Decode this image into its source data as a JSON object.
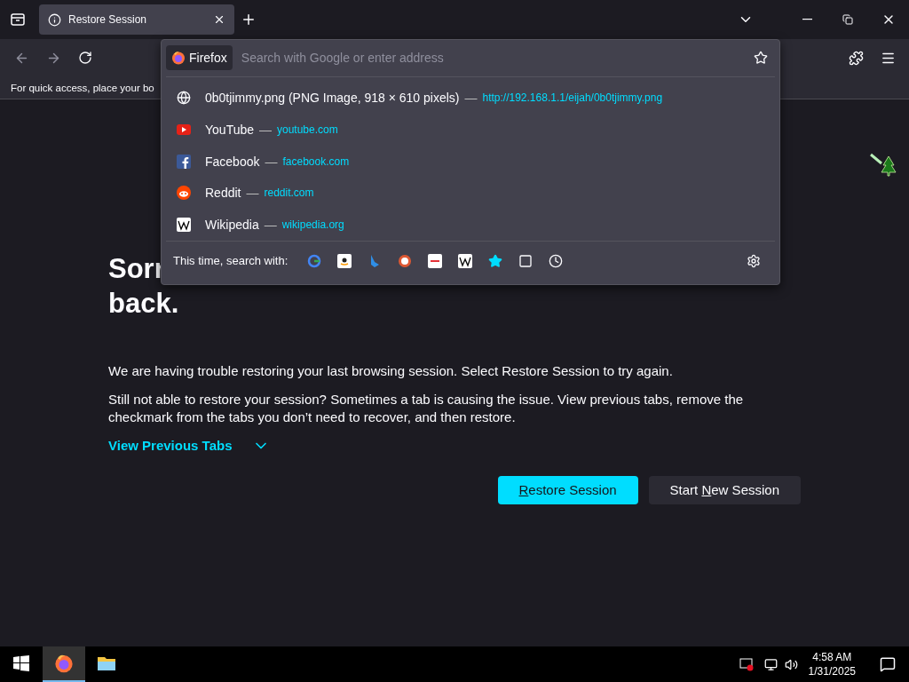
{
  "tabs": [
    {
      "title": "Restore Session",
      "selected": true
    }
  ],
  "urlbar": {
    "identity": "Firefox",
    "placeholder": "Search with Google or enter address"
  },
  "bookmarks_bar": {
    "text": "For quick access, place your bo"
  },
  "suggestions": [
    {
      "kind": "globe",
      "title": "0b0tjimmy.png (PNG Image, 918 × 610 pixels)",
      "separator": "—",
      "url": "http://192.168.1.1/eijah/0b0tjimmy.png"
    },
    {
      "kind": "youtube",
      "title": "YouTube",
      "separator": "—",
      "url": "youtube.com"
    },
    {
      "kind": "facebook",
      "title": "Facebook",
      "separator": "—",
      "url": "facebook.com"
    },
    {
      "kind": "reddit",
      "title": "Reddit",
      "separator": "—",
      "url": "reddit.com"
    },
    {
      "kind": "wikipedia",
      "title": "Wikipedia",
      "separator": "—",
      "url": "wikipedia.org"
    }
  ],
  "search_with": {
    "label": "This time, search with:"
  },
  "page": {
    "heading_lines": [
      "Sorr",
      "back."
    ],
    "paragraphs": [
      "We are having trouble restoring your last browsing session. Select Restore Session to try again.",
      "Still not able to restore your session? Sometimes a tab is causing the issue. View previous tabs, remove the checkmark from the tabs you don’t need to recover, and then restore."
    ],
    "toggle": {
      "label": "View Previous Tabs",
      "expanded": false
    },
    "buttons": [
      {
        "accesskey": "R",
        "label_after": "estore Session",
        "primary": true
      },
      {
        "label_before": "Start ",
        "accesskey": "N",
        "label_after": "ew Session",
        "primary": false
      }
    ]
  },
  "taskbar": {
    "apps": [
      {
        "kind": "firefox",
        "active": true
      },
      {
        "kind": "explorer",
        "active": false
      }
    ],
    "time": "4:58 AM",
    "date": "1/31/2025"
  }
}
